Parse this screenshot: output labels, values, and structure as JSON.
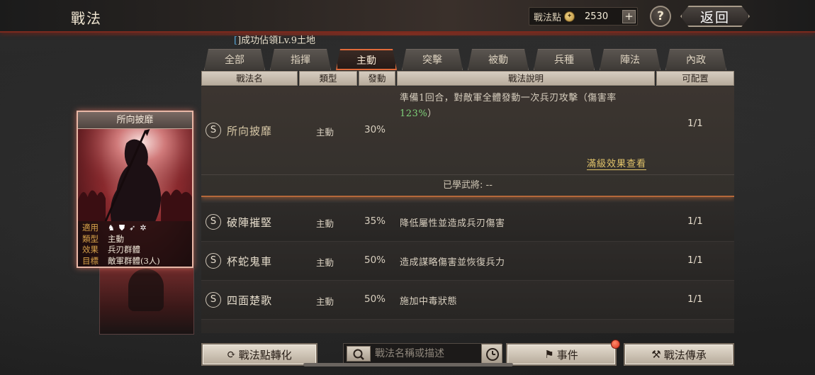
{
  "header": {
    "title": "戰法",
    "points_label": "戰法點",
    "points_value": "2530",
    "add_symbol": "+",
    "help_symbol": "?",
    "back_label": "返回"
  },
  "notice": {
    "bracket": "[",
    "text": "]成功佔領Lv.9土地"
  },
  "tabs": [
    {
      "label": "全部",
      "active": false
    },
    {
      "label": "指揮",
      "active": false
    },
    {
      "label": "主動",
      "active": true
    },
    {
      "label": "突擊",
      "active": false
    },
    {
      "label": "被動",
      "active": false
    },
    {
      "label": "兵種",
      "active": false
    },
    {
      "label": "陣法",
      "active": false
    },
    {
      "label": "內政",
      "active": false
    }
  ],
  "columns": {
    "name": "戰法名",
    "kind": "類型",
    "rate": "發動",
    "desc": "戰法說明",
    "count": "可配置"
  },
  "card": {
    "title": "所向披靡",
    "rows": [
      {
        "key": "適用",
        "icons": [
          "horse-icon",
          "shield-icon",
          "spear-icon",
          "wheel-icon"
        ]
      },
      {
        "key": "類型",
        "value": "主動"
      },
      {
        "key": "效果",
        "value": "兵刃群體"
      },
      {
        "key": "目標",
        "value": "敵軍群體(3人)"
      }
    ]
  },
  "tactics": [
    {
      "grade": "S",
      "name": "所向披靡",
      "kind": "主動",
      "rate": "30%",
      "desc_pre": "準備1回合，對敵軍全體發動一次兵刃攻擊（傷害率",
      "desc_highlight": "123%",
      "desc_post": "）",
      "count": "1/1",
      "max_link": "滿級效果查看",
      "learned": "已學武將:  --"
    },
    {
      "grade": "S",
      "name": "破陣摧堅",
      "kind": "主動",
      "rate": "35%",
      "desc": "降低屬性並造成兵刃傷害",
      "count": "1/1"
    },
    {
      "grade": "S",
      "name": "杯蛇鬼車",
      "kind": "主動",
      "rate": "50%",
      "desc": "造成謀略傷害並恢復兵力",
      "count": "1/1"
    },
    {
      "grade": "S",
      "name": "四面楚歌",
      "kind": "主動",
      "rate": "50%",
      "desc": "施加中毒狀態",
      "count": "1/1"
    }
  ],
  "bottom": {
    "convert_label": "戰法點轉化",
    "search_placeholder": "戰法名稱或描述",
    "events_label": "事件",
    "inherit_label": "戰法傳承"
  },
  "colors": {
    "active_tab_glow": "#e06a3a",
    "highlight_green": "#7fd27a",
    "link_gold": "#e2c46a",
    "card_frame": "#e8b7a6"
  }
}
